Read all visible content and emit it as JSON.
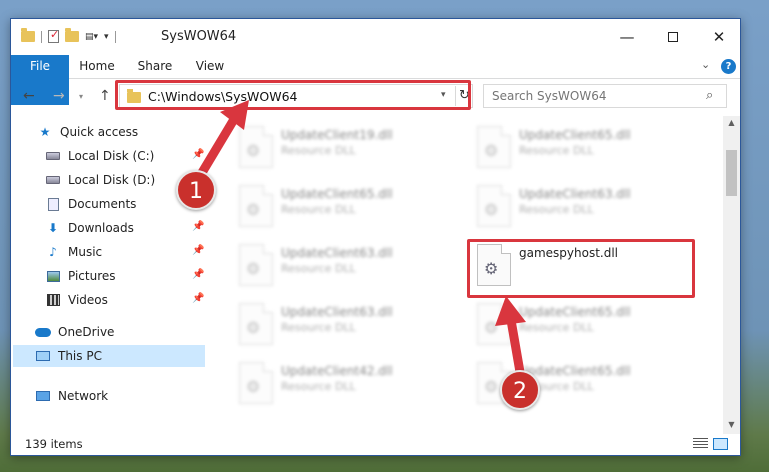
{
  "window": {
    "title": "SysWOW64",
    "minimize_label": "—",
    "maximize_label": "",
    "close_label": "✕"
  },
  "ribbon": {
    "tabs": [
      "File",
      "Home",
      "Share",
      "View"
    ],
    "help_label": "?",
    "expand_label": "⌄"
  },
  "address": {
    "path": "C:\\Windows\\SysWOW64",
    "back_label": "←",
    "forward_label": "→",
    "up_label": "↑",
    "refresh_label": "↻"
  },
  "search": {
    "placeholder": "Search SysWOW64"
  },
  "nav_pane": {
    "items": [
      {
        "label": "Quick access",
        "icon": "star-icon"
      },
      {
        "label": "Local Disk (C:)",
        "icon": "disk-icon",
        "pinned": true
      },
      {
        "label": "Local Disk (D:)",
        "icon": "disk-icon",
        "pinned": false
      },
      {
        "label": "Documents",
        "icon": "document-icon",
        "pinned": true
      },
      {
        "label": "Downloads",
        "icon": "download-icon",
        "pinned": true
      },
      {
        "label": "Music",
        "icon": "music-icon",
        "pinned": true
      },
      {
        "label": "Pictures",
        "icon": "pictures-icon",
        "pinned": true
      },
      {
        "label": "Videos",
        "icon": "video-icon",
        "pinned": true
      },
      {
        "label": "OneDrive",
        "icon": "cloud-icon"
      },
      {
        "label": "This PC",
        "icon": "computer-icon",
        "selected": true
      },
      {
        "label": "Network",
        "icon": "network-icon"
      }
    ]
  },
  "files": [
    {
      "name": "UpdateClient19.dll",
      "type": "Resource DLL"
    },
    {
      "name": "UpdateClient65.dll",
      "type": "Resource DLL"
    },
    {
      "name": "UpdateClient65.dll",
      "type": "Resource DLL"
    },
    {
      "name": "UpdateClient63.dll",
      "type": "Resource DLL"
    },
    {
      "name": "UpdateClient63.dll",
      "type": "Resource DLL"
    },
    {
      "name": "gamespyhost.dll",
      "type": ""
    },
    {
      "name": "UpdateClient63.dll",
      "type": "Resource DLL"
    },
    {
      "name": "UpdateClient65.dll",
      "type": "Resource DLL"
    },
    {
      "name": "UpdateClient42.dll",
      "type": "Resource DLL"
    },
    {
      "name": "UpdateClient65.dll",
      "type": "Resource DLL"
    }
  ],
  "status_bar": {
    "item_count": "139 items"
  },
  "annotations": {
    "step1": "1",
    "step2": "2",
    "color": "#d9363e"
  }
}
